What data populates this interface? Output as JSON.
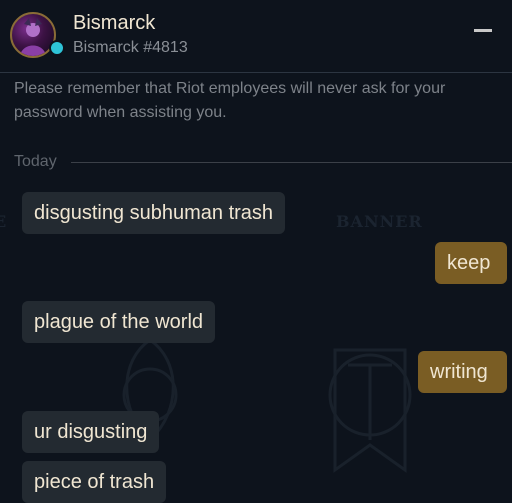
{
  "header": {
    "name": "Bismarck",
    "tag": "Bismarck #4813"
  },
  "notice": "Please remember that Riot employees will never ask for your password when assisting you.",
  "divider": {
    "label": "Today"
  },
  "background": {
    "words": [
      "E",
      "BANNER"
    ]
  },
  "messages": [
    {
      "direction": "in",
      "text": "disgusting subhuman trash"
    },
    {
      "direction": "out",
      "text": "keep"
    },
    {
      "direction": "in",
      "text": "plague of the world"
    },
    {
      "direction": "out",
      "text": "writing"
    },
    {
      "direction": "in",
      "text": "ur disgusting"
    },
    {
      "direction": "in",
      "text": "piece of trash"
    }
  ],
  "colors": {
    "background": "#0d131c",
    "incoming_bubble": "#232a31",
    "outgoing_bubble": "#7a5d24",
    "text": "#f0e6d2",
    "status_online": "#2ec4d8"
  }
}
